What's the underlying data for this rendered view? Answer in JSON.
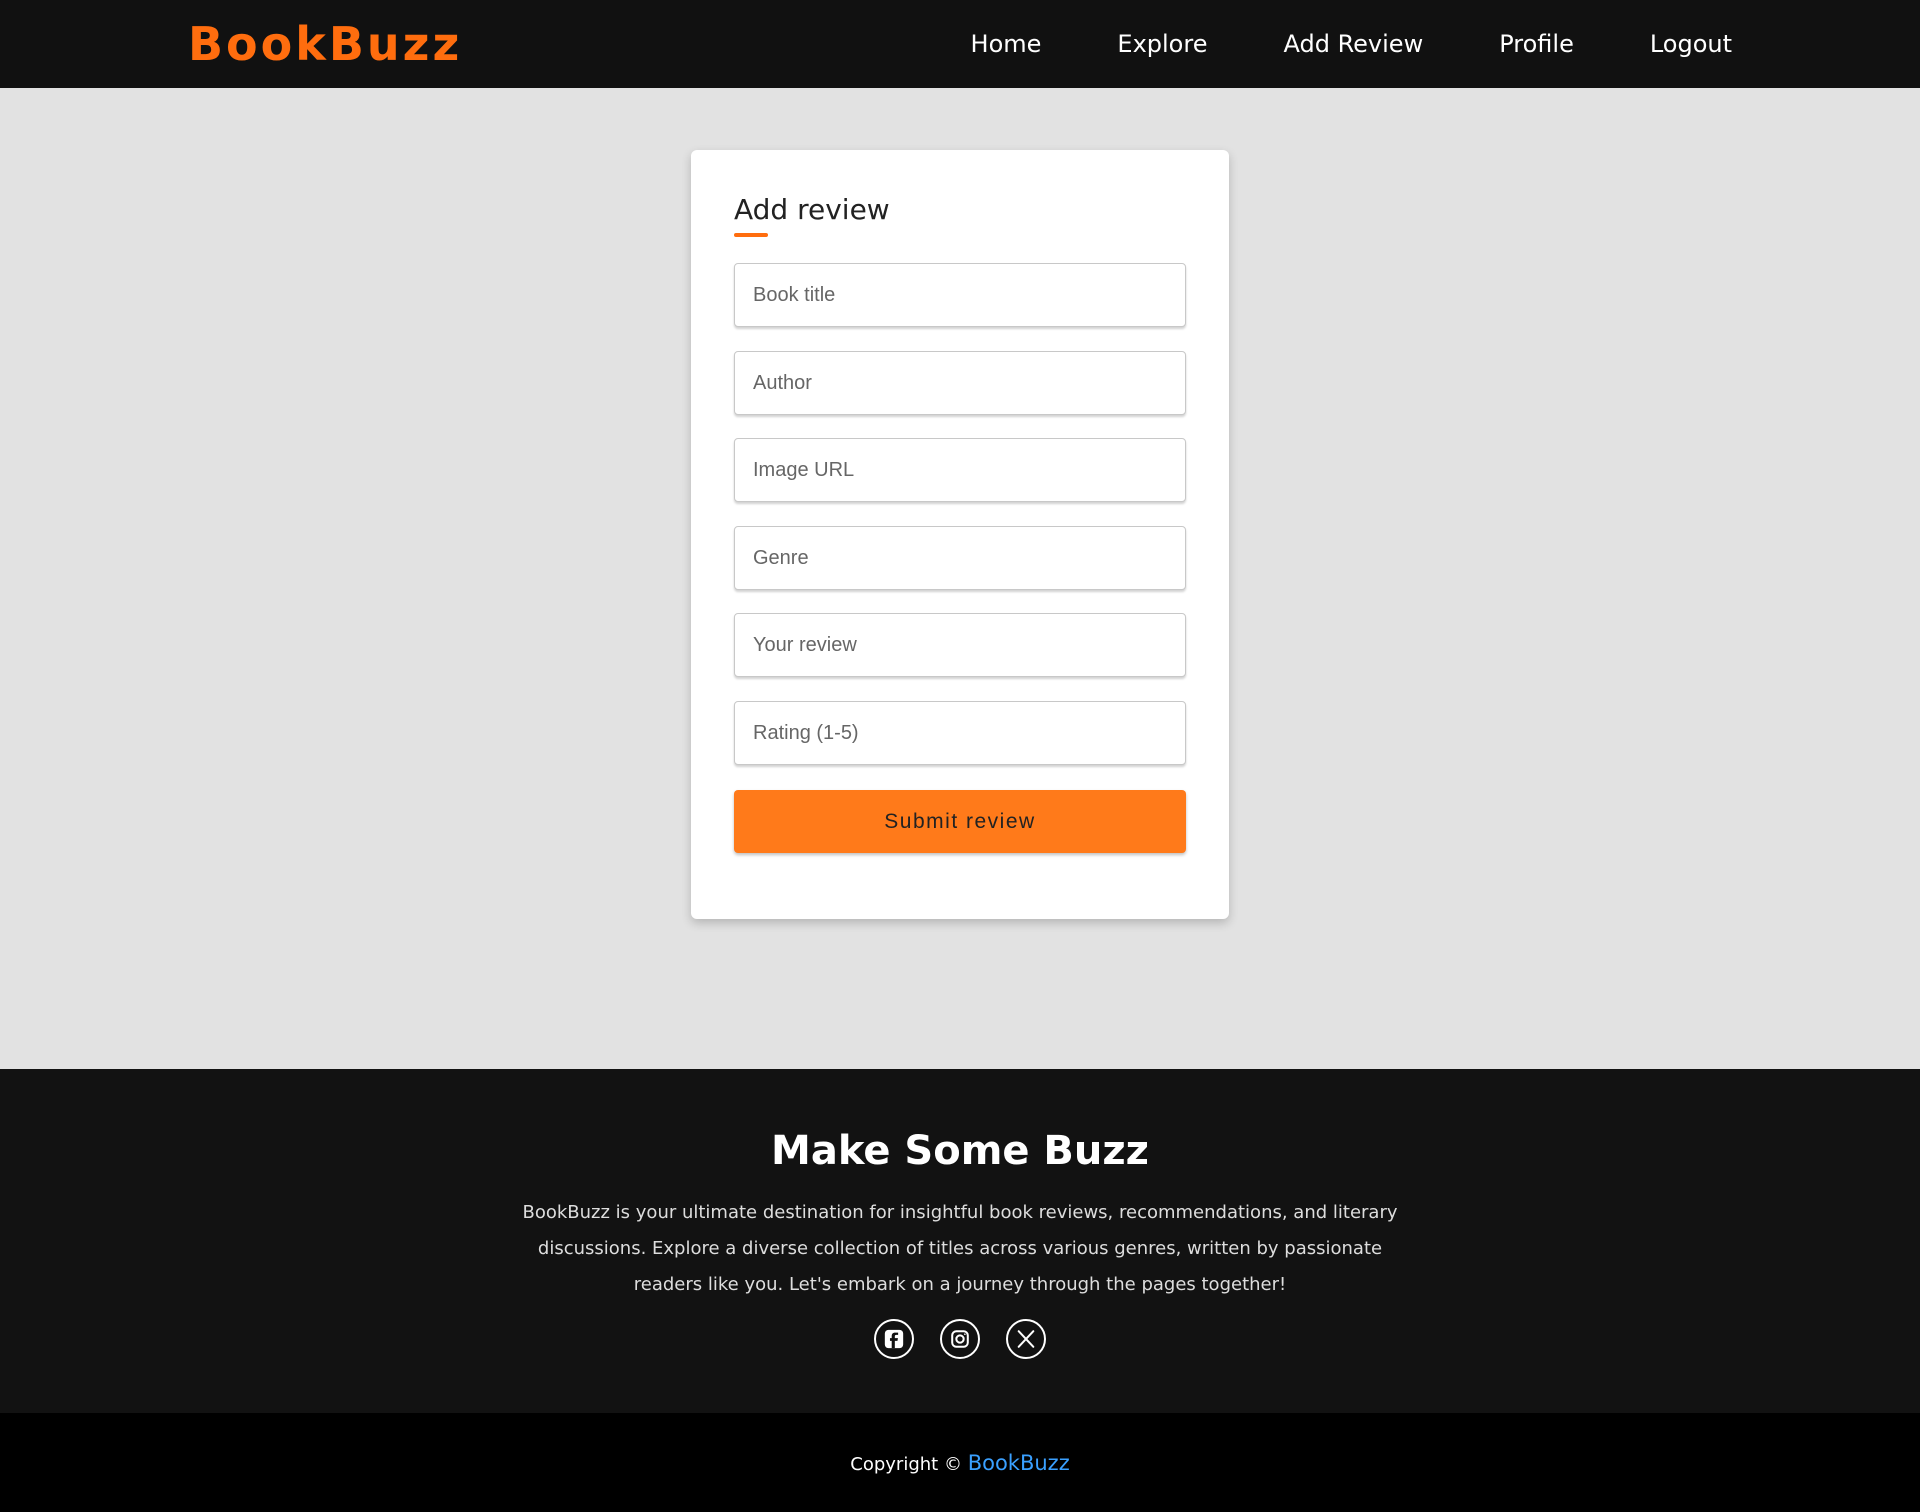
{
  "nav": {
    "brand": "BookBuzz",
    "links": [
      "Home",
      "Explore",
      "Add Review",
      "Profile",
      "Logout"
    ]
  },
  "form": {
    "title": "Add review",
    "fields": {
      "book_title": "Book title",
      "author": "Author",
      "image_url": "Image URL",
      "genre": "Genre",
      "review": "Your review",
      "rating": "Rating (1-5)"
    },
    "submit_label": "Submit review"
  },
  "footer": {
    "title": "Make Some Buzz",
    "description": "BookBuzz is your ultimate destination for insightful book reviews, recommendations, and literary discussions. Explore a diverse collection of titles across various genres, written by passionate readers like you. Let's embark on a journey through the pages together!",
    "socials": [
      "facebook-icon",
      "instagram-icon",
      "x-icon"
    ]
  },
  "copyright": {
    "prefix": "Copyright ©",
    "link": "BookBuzz"
  },
  "colors": {
    "accent": "#ff6d0e",
    "button": "#ff7a1a",
    "nav_bg": "#111111",
    "page_bg": "#e2e2e2",
    "link": "#3aa0ff"
  }
}
